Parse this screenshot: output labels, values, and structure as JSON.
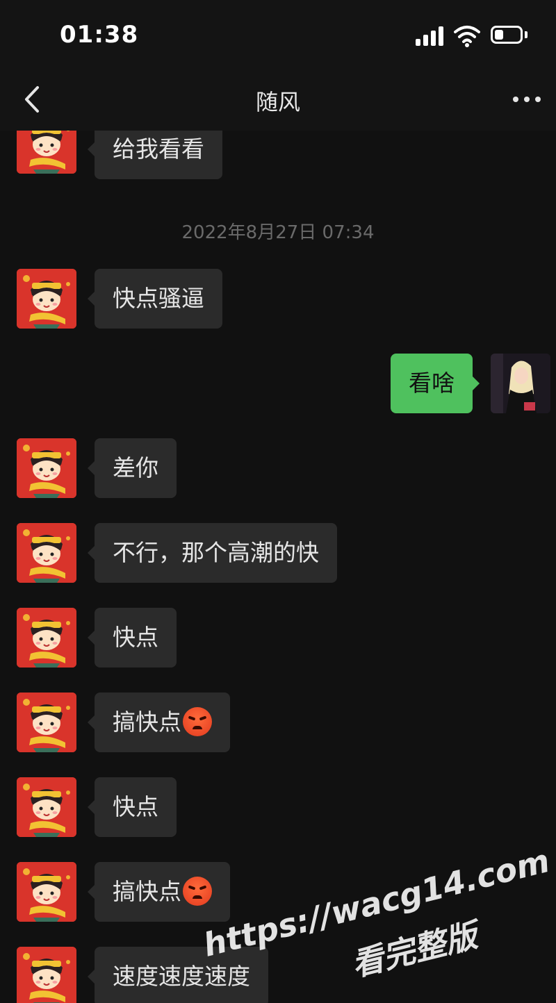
{
  "status_bar": {
    "time": "01:38",
    "battery_level": 0.35
  },
  "nav": {
    "title": "随风"
  },
  "messages": [
    {
      "sender": "other",
      "text": "给我看看"
    },
    {
      "type": "timestamp",
      "text": "2022年8月27日 07:34"
    },
    {
      "sender": "other",
      "text": "快点骚逼"
    },
    {
      "sender": "me",
      "text": "看啥"
    },
    {
      "sender": "other",
      "text": "差你"
    },
    {
      "sender": "other",
      "text": "不行，那个高潮的快"
    },
    {
      "sender": "other",
      "text": "快点"
    },
    {
      "sender": "other",
      "text": "搞快点",
      "emoji": "angry-face"
    },
    {
      "sender": "other",
      "text": "快点"
    },
    {
      "sender": "other",
      "text": "搞快点",
      "emoji": "angry-face"
    },
    {
      "sender": "other",
      "text": "速度速度速度"
    }
  ],
  "watermark": {
    "url": "https://wacg14.com",
    "text": "看完整版"
  },
  "icons": [
    "back-icon",
    "more-icon",
    "signal-icon",
    "wifi-icon",
    "battery-icon",
    "angry-face-emoji"
  ],
  "colors": {
    "background": "#111111",
    "bubble_other": "#2b2b2b",
    "bubble_mine": "#4fc15e",
    "avatar_red": "#d9342b"
  }
}
